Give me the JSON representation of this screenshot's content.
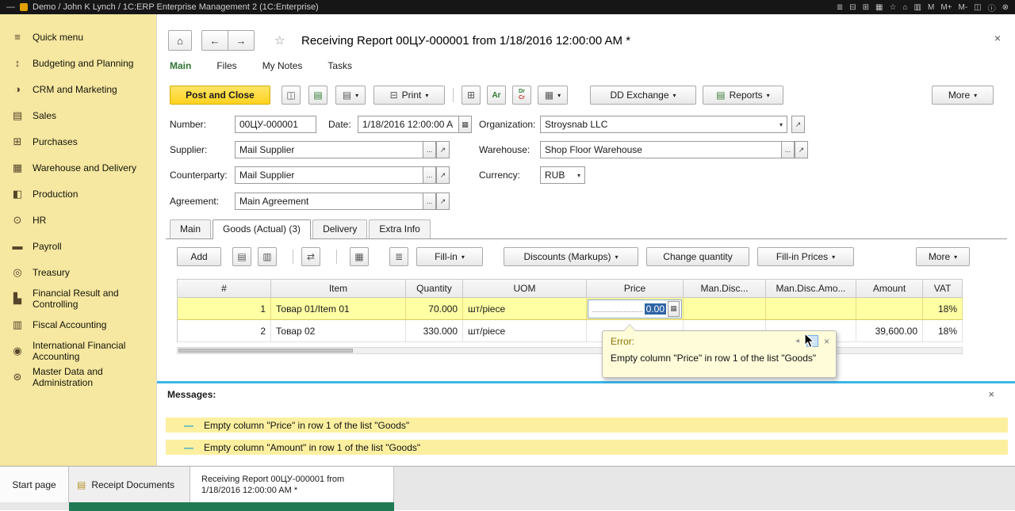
{
  "colors": {
    "sidebar_bg": "#f6e7a1",
    "accent_yellow": "#ffd21e",
    "active_tab_green": "#2f7433",
    "row_highlight": "#ffffa4",
    "message_bg": "#fcf0a0",
    "blue_separator": "#3db6e8",
    "taskbar_green": "#1f7a54",
    "selection_blue": "#2e63a4"
  },
  "icons": {
    "dash": "—",
    "home": "⌂",
    "back": "←",
    "forward": "→",
    "star": "☆",
    "close": "×",
    "caret": "▾",
    "dots": "...",
    "open": "↗",
    "calendar": "▦",
    "save": "◫",
    "post_doc": "▤",
    "based_on": "▤",
    "print": "⊟",
    "calc": "⊞",
    "calc_small": "▦",
    "copy": "▤",
    "paste": "▥",
    "move": "⇄",
    "flag": "▦",
    "list": "≣",
    "doc": "▤",
    "prev": "◂",
    "next": "▸"
  },
  "titlebar": {
    "title": "Demo / John K Lynch / 1C:ERP Enterprise Management 2  (1C:Enterprise)",
    "right_icons": [
      {
        "name": "keyboard-icon",
        "glyph": "≣"
      },
      {
        "name": "print-icon",
        "glyph": "⊟"
      },
      {
        "name": "calculator-icon",
        "glyph": "⊞"
      },
      {
        "name": "calendar-icon",
        "glyph": "▦"
      },
      {
        "name": "star-icon",
        "glyph": "☆"
      },
      {
        "name": "home-icon",
        "glyph": "⌂"
      },
      {
        "name": "clipboard-icon",
        "glyph": "▥"
      },
      {
        "name": "m-button",
        "glyph": "M"
      },
      {
        "name": "m-plus-button",
        "glyph": "M+"
      },
      {
        "name": "m-minus-button",
        "glyph": "M-"
      },
      {
        "name": "window-icon",
        "glyph": "◫"
      },
      {
        "name": "info-icon",
        "glyph": "ⓘ"
      },
      {
        "name": "power-icon",
        "glyph": "⊗"
      }
    ]
  },
  "sidebar": {
    "items": [
      {
        "label": "Quick menu",
        "glyph": "≡"
      },
      {
        "label": "Budgeting and Planning",
        "glyph": "↕"
      },
      {
        "label": "CRM and Marketing",
        "glyph": "◑"
      },
      {
        "label": "Sales",
        "glyph": "▤"
      },
      {
        "label": "Purchases",
        "glyph": "⊞"
      },
      {
        "label": "Warehouse and Delivery",
        "glyph": "▦"
      },
      {
        "label": "Production",
        "glyph": "◧"
      },
      {
        "label": "HR",
        "glyph": "⊙"
      },
      {
        "label": "Payroll",
        "glyph": "▬"
      },
      {
        "label": "Treasury",
        "glyph": "◎"
      },
      {
        "label": "Financial Result and Controlling",
        "glyph": "▙"
      },
      {
        "label": "Fiscal Accounting",
        "glyph": "▥"
      },
      {
        "label": "International Financial Accounting",
        "glyph": "◉"
      },
      {
        "label": "Master Data and Administration",
        "glyph": "⊛"
      }
    ]
  },
  "nav": {
    "title": "Receiving Report 00ЦУ-000001 from 1/18/2016 12:00:00 AM *"
  },
  "tabs": {
    "main": "Main",
    "files": "Files",
    "notes": "My Notes",
    "tasks": "Tasks"
  },
  "toolbar": {
    "post_close": "Post and Close",
    "print": "Print",
    "dd_exchange": "DD Exchange",
    "reports": "Reports",
    "more": "More",
    "ar": "Ar",
    "dr": "Dr",
    "cr": "Cr"
  },
  "form": {
    "number_label": "Number:",
    "number_value": "00ЦУ-000001",
    "date_label": "Date:",
    "date_value": "1/18/2016 12:00:00 A",
    "organization_label": "Organization:",
    "organization_value": "Stroysnab LLC",
    "supplier_label": "Supplier:",
    "supplier_value": "Mail Supplier",
    "warehouse_label": "Warehouse:",
    "warehouse_value": "Shop Floor Warehouse",
    "counterparty_label": "Counterparty:",
    "counterparty_value": "Mail Supplier",
    "currency_label": "Currency:",
    "currency_value": "RUB",
    "agreement_label": "Agreement:",
    "agreement_value": "Main Agreement"
  },
  "detail_tabs": {
    "main": "Main",
    "goods": "Goods (Actual) (3)",
    "delivery": "Delivery",
    "extra": "Extra Info"
  },
  "table_toolbar": {
    "add": "Add",
    "fill_in": "Fill-in",
    "discounts": "Discounts (Markups)",
    "change_quantity": "Change quantity",
    "fill_in_prices": "Fill-in Prices",
    "more": "More"
  },
  "table": {
    "columns": [
      "#",
      "Item",
      "Quantity",
      "UOM",
      "Price",
      "Man.Disc...",
      "Man.Disc.Amo...",
      "Amount",
      "VAT"
    ],
    "rows": [
      {
        "num": "1",
        "item": "Товар 01/Item 01",
        "quantity": "70.000",
        "uom": "шт/piece",
        "price": "0.00",
        "man_disc": "",
        "man_disc_amount": "",
        "amount": "",
        "vat": "18%"
      },
      {
        "num": "2",
        "item": "Товар 02",
        "quantity": "330.000",
        "uom": "шт/piece",
        "price": "",
        "man_disc": "",
        "man_disc_amount": "",
        "amount": "39,600.00",
        "vat": "18%"
      }
    ]
  },
  "tooltip": {
    "title": "Error:",
    "text": "Empty column \"Price\" in row 1 of the list \"Goods\""
  },
  "messages": {
    "title": "Messages:",
    "items": [
      {
        "text": "Empty column \"Price\" in row 1 of the list \"Goods\""
      },
      {
        "text": "Empty column \"Amount\" in row 1 of the list \"Goods\""
      }
    ]
  },
  "taskbar": {
    "start": "Start page",
    "receipt": "Receipt Documents",
    "active_line1": "Receiving Report 00ЦУ-000001 from",
    "active_line2": "1/18/2016 12:00:00 AM *"
  }
}
